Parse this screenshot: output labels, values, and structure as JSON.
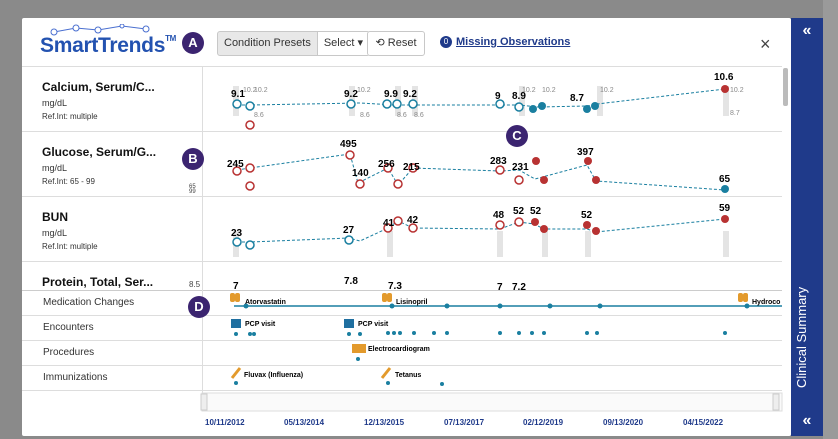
{
  "header": {
    "logo": "SmartTrends",
    "logo_tm": "TM",
    "preset_label": "Condition Presets",
    "preset_select": "Select ▾",
    "reset_label": "Reset",
    "missing_count": "0",
    "missing_label": "Missing Observations",
    "close_label": "×"
  },
  "badges": [
    "A",
    "B",
    "C",
    "D"
  ],
  "labs": [
    {
      "name": "Calcium, Serum/C...",
      "unit": "mg/dL",
      "ref": "Ref.Int: multiple"
    },
    {
      "name": "Glucose, Serum/G...",
      "unit": "mg/dL",
      "ref": "Ref.Int: 65 - 99"
    },
    {
      "name": "BUN",
      "unit": "mg/dL",
      "ref": "Ref.Int: multiple"
    },
    {
      "name": "Protein, Total, Ser...",
      "unit": "",
      "ref": ""
    }
  ],
  "timeline_rows": [
    "Medication Changes",
    "Encounters",
    "Procedures",
    "Immunizations"
  ],
  "events": {
    "meds": [
      "Atorvastatin",
      "Lisinopril",
      "Hydroco"
    ],
    "encounters": [
      "PCP visit",
      "PCP visit"
    ],
    "procedures": [
      "Electrocardiogram"
    ],
    "immunizations": [
      "Fluvax (Influenza)",
      "Tetanus"
    ]
  },
  "dates": [
    "10/11/2012",
    "05/13/2014",
    "12/13/2015",
    "07/13/2017",
    "02/12/2019",
    "09/13/2020",
    "04/15/2022"
  ],
  "side_panel": {
    "label": "Clinical Summary",
    "chev_top": "«",
    "chev_bottom": "«"
  },
  "colors": {
    "accent": "#2352b0",
    "panel": "#1f3a8a",
    "abnormal": "#b83232",
    "normal": "#1a7fa0",
    "badge": "#3b2470"
  }
}
